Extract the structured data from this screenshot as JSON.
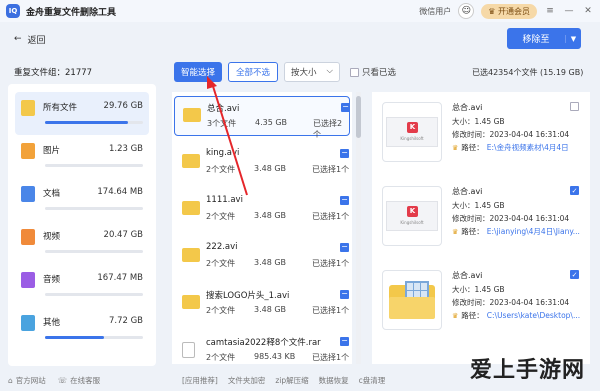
{
  "app": {
    "logo_text": "IQ",
    "title": "金舟重复文件删除工具",
    "user": "微信用户",
    "vip_label": "开通会员"
  },
  "window_controls": {
    "menu": "≡",
    "minimize": "—",
    "close": "✕"
  },
  "nav": {
    "back_label": "返回",
    "remove_label": "移除至",
    "remove_arrow": "▼"
  },
  "left": {
    "header": "重复文件组：21777",
    "categories": [
      {
        "label": "所有文件",
        "size": "29.76 GB",
        "icon": "folder-icon",
        "color": "#f3c84a",
        "fill": 0.85,
        "active": true
      },
      {
        "label": "图片",
        "size": "1.23 GB",
        "icon": "image-icon",
        "color": "#f2a23a",
        "fill": 0
      },
      {
        "label": "文档",
        "size": "174.64 MB",
        "icon": "document-icon",
        "color": "#4a86e8",
        "fill": 0
      },
      {
        "label": "视频",
        "size": "20.47 GB",
        "icon": "video-icon",
        "color": "#f08a3a",
        "fill": 0
      },
      {
        "label": "音频",
        "size": "167.47 MB",
        "icon": "music-icon",
        "color": "#9b5de5",
        "fill": 0
      },
      {
        "label": "其他",
        "size": "7.72 GB",
        "icon": "other-files-icon",
        "color": "#4aa3df",
        "fill": 0.6
      }
    ]
  },
  "toolbar": {
    "smart_select": "智能选择",
    "deselect_all": "全部不选",
    "sort": "按大小",
    "sort_arrow": "⌵",
    "only_selected": "只看已选",
    "selected_stat": "已选42354个文件 (15.19 GB)"
  },
  "groups": [
    {
      "name": "总合.avi",
      "count": "3个文件",
      "size": "4.35 GB",
      "selected": "已选择2个",
      "icon": "folder",
      "highlight": true
    },
    {
      "name": "king.avi",
      "count": "2个文件",
      "size": "3.48 GB",
      "selected": "已选择1个",
      "icon": "folder"
    },
    {
      "name": "1111.avi",
      "count": "2个文件",
      "size": "3.48 GB",
      "selected": "已选择1个",
      "icon": "folder"
    },
    {
      "name": "222.avi",
      "count": "2个文件",
      "size": "3.48 GB",
      "selected": "已选择1个",
      "icon": "folder"
    },
    {
      "name": "搜索LOGO片头_1.avi",
      "count": "2个文件",
      "size": "3.48 GB",
      "selected": "已选择1个",
      "icon": "folder"
    },
    {
      "name": "camtasia2022释8个文件.rar",
      "count": "2个文件",
      "size": "985.43 KB",
      "selected": "已选择1个",
      "icon": "doc"
    }
  ],
  "details": [
    {
      "name": "总合.avi",
      "size": "大小：1.45 GB",
      "time": "修改时间：2023-04-04 16:31:04",
      "path_label": "路径：",
      "path": "E:\\金舟视频素材\\4月4日",
      "checked": false,
      "thumb": "video",
      "thumb_text": "KingshiIsoft"
    },
    {
      "name": "总合.avi",
      "size": "大小：1.45 GB",
      "time": "修改时间：2023-04-04 16:31:04",
      "path_label": "路径：",
      "path": "E:\\jianying\\4月4日\\Jiany...",
      "checked": true,
      "thumb": "video",
      "thumb_text": "KingshiIsoft"
    },
    {
      "name": "总合.avi",
      "size": "大小：1.45 GB",
      "time": "修改时间：2023-04-04 16:31:04",
      "path_label": "路径：",
      "path": "C:\\Users\\kate\\Desktop\\...",
      "checked": true,
      "thumb": "folder"
    }
  ],
  "footer": {
    "official": "官方网站",
    "service": "在线客服",
    "links": [
      "[应用推荐]",
      "文件夹加密",
      "zip解压缩",
      "数据恢复",
      "c盘清理"
    ]
  },
  "watermark": "爱上手游网"
}
